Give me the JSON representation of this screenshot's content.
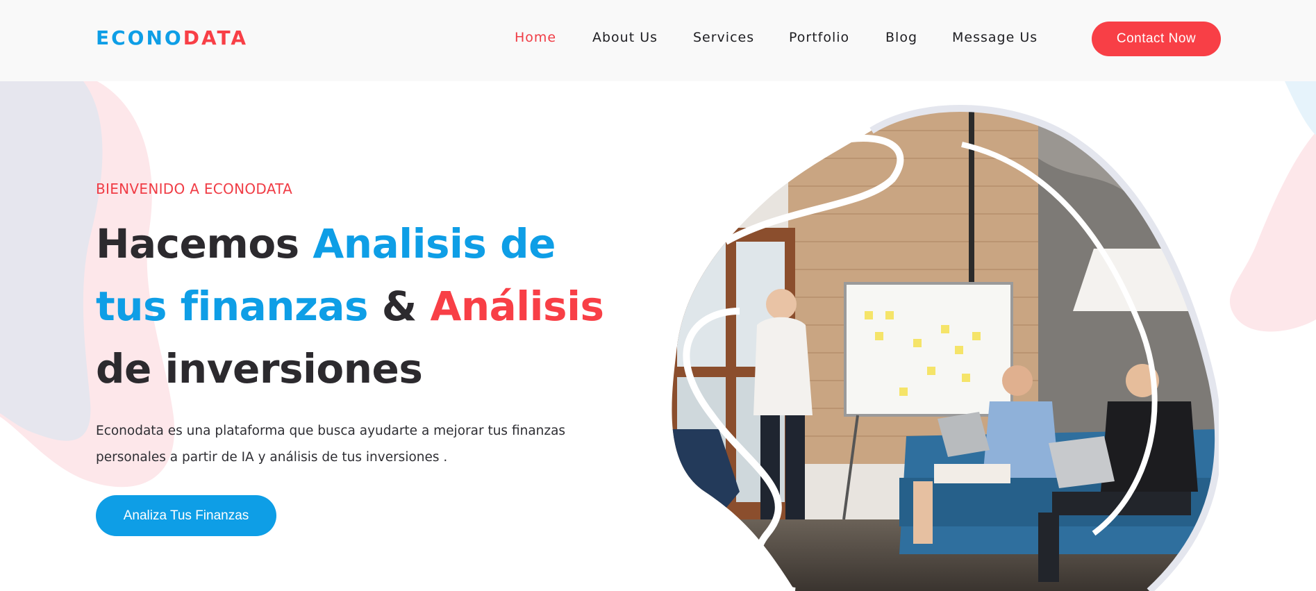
{
  "brand": {
    "part1": "ECONO",
    "part2": "DATA"
  },
  "nav": {
    "items": [
      {
        "label": "Home",
        "active": true
      },
      {
        "label": "About Us",
        "active": false
      },
      {
        "label": "Services",
        "active": false
      },
      {
        "label": "Portfolio",
        "active": false
      },
      {
        "label": "Blog",
        "active": false
      },
      {
        "label": "Message Us",
        "active": false
      }
    ],
    "contact_label": "Contact Now"
  },
  "hero": {
    "eyebrow": "BIENVENIDO A ECONODATA",
    "headline": {
      "p1": "Hacemos ",
      "p2": "Analisis de",
      "p3": "tus finanzas",
      "p4": " & ",
      "p5": "Análisis",
      "p6": "de inversiones"
    },
    "description_line1": "Econodata es una plataforma que busca ayudarte a mejorar tus finanzas",
    "description_line2": "personales a partir de IA y análisis de tus inversiones .",
    "cta_label": "Analiza Tus Finanzas",
    "image_icon": "team-meeting-photo"
  },
  "colors": {
    "accent_red": "#f83f46",
    "accent_blue": "#0e9ee6",
    "text_dark": "#2c2a2e",
    "header_bg": "#f9f9f9"
  }
}
